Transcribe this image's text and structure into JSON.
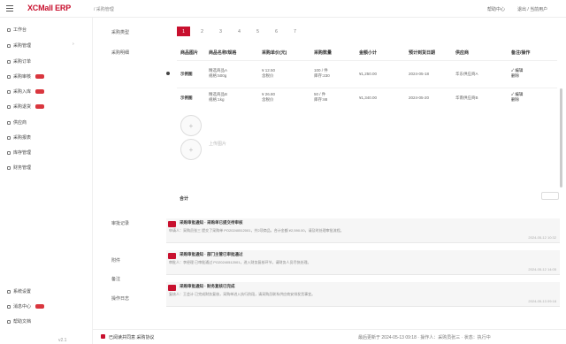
{
  "header": {
    "logo": "XCMall ERP",
    "crumb": "/ 采购管理",
    "right_links": [
      "帮助中心",
      "退出 / 当前用户"
    ]
  },
  "sidebar": {
    "items": [
      {
        "label": "工作台",
        "badge": false
      },
      {
        "label": "采购管理",
        "badge": false
      },
      {
        "label": "采购订单",
        "badge": false
      },
      {
        "label": "采购审核",
        "badge": true
      },
      {
        "label": "采购入库",
        "badge": true
      },
      {
        "label": "采购退货",
        "badge": true
      },
      {
        "label": "供应商",
        "badge": false
      },
      {
        "label": "采购报表",
        "badge": false
      },
      {
        "label": "库存管理",
        "badge": false
      },
      {
        "label": "财务管理",
        "badge": false
      }
    ],
    "bottom_items": [
      {
        "label": "系统设置",
        "badge": false
      },
      {
        "label": "消息中心",
        "badge": true
      },
      {
        "label": "帮助文档",
        "badge": false
      }
    ],
    "arrow": "›",
    "version": "v2.1"
  },
  "form": {
    "field_label_1": "采购类型",
    "field_label_2": "采购明细",
    "pages": [
      "1",
      "2",
      "3",
      "4",
      "5",
      "6",
      "7"
    ],
    "active_page": "1",
    "columns": [
      "商品图片",
      "商品名称/规格",
      "采购单价(元)",
      "采购数量",
      "金额小计",
      "预计到货日期",
      "供应商",
      "备注/操作"
    ],
    "rows": [
      {
        "img": "示例图",
        "name": "精选商品A\n规格:500g",
        "price": "¥ 12.50\n含税价",
        "qty": "100 / 件\n库存:230",
        "subtotal": "¥1,250.00",
        "date": "2024-05-18",
        "supplier": "华东供应商A",
        "op": "✓ 编辑\n删除"
      },
      {
        "img": "示例图",
        "name": "精选商品B\n规格:1kg",
        "price": "¥ 26.80\n含税价",
        "qty": "50 / 件\n库存:88",
        "subtotal": "¥1,340.00",
        "date": "2024-05-20",
        "supplier": "华南供应商B",
        "op": "✓ 编辑\n删除"
      }
    ],
    "upload_hint": "上传图片",
    "total": "合计"
  },
  "comments": {
    "label_log": "审批记录",
    "label_1": "附件",
    "label_2": "备注",
    "label_3": "操作日志",
    "messages": [
      {
        "title": "采购审批通知 · 采购单已提交待审核",
        "body": "申请人：采购员张三  提交了采购单 PO20240512001，共2项商品，合计金额 ¥2,590.00，请及时处理审批流程。",
        "time": "2024-05-12 10:32"
      },
      {
        "title": "采购审批通知 · 部门主管已审批通过",
        "body": "审批人：李经理  已审批通过 PO20240512001，进入财务复核环节，请财务人员尽快处理。",
        "time": "2024-05-12 14:05"
      },
      {
        "title": "采购审批通知 · 财务复核已完成",
        "body": "复核人：王会计  已完成财务复核，采购单进入执行阶段，请采购员联系供应商安排发货事宜。",
        "time": "2024-05-13 09:18"
      }
    ]
  },
  "footer": {
    "left": "已阅读并同意 采购协议",
    "right": "最后更新于 2024-05-13 09:18  ·  操作人：采购员张三  ·  状态：执行中"
  },
  "colors": {
    "brand": "#c8102e"
  }
}
